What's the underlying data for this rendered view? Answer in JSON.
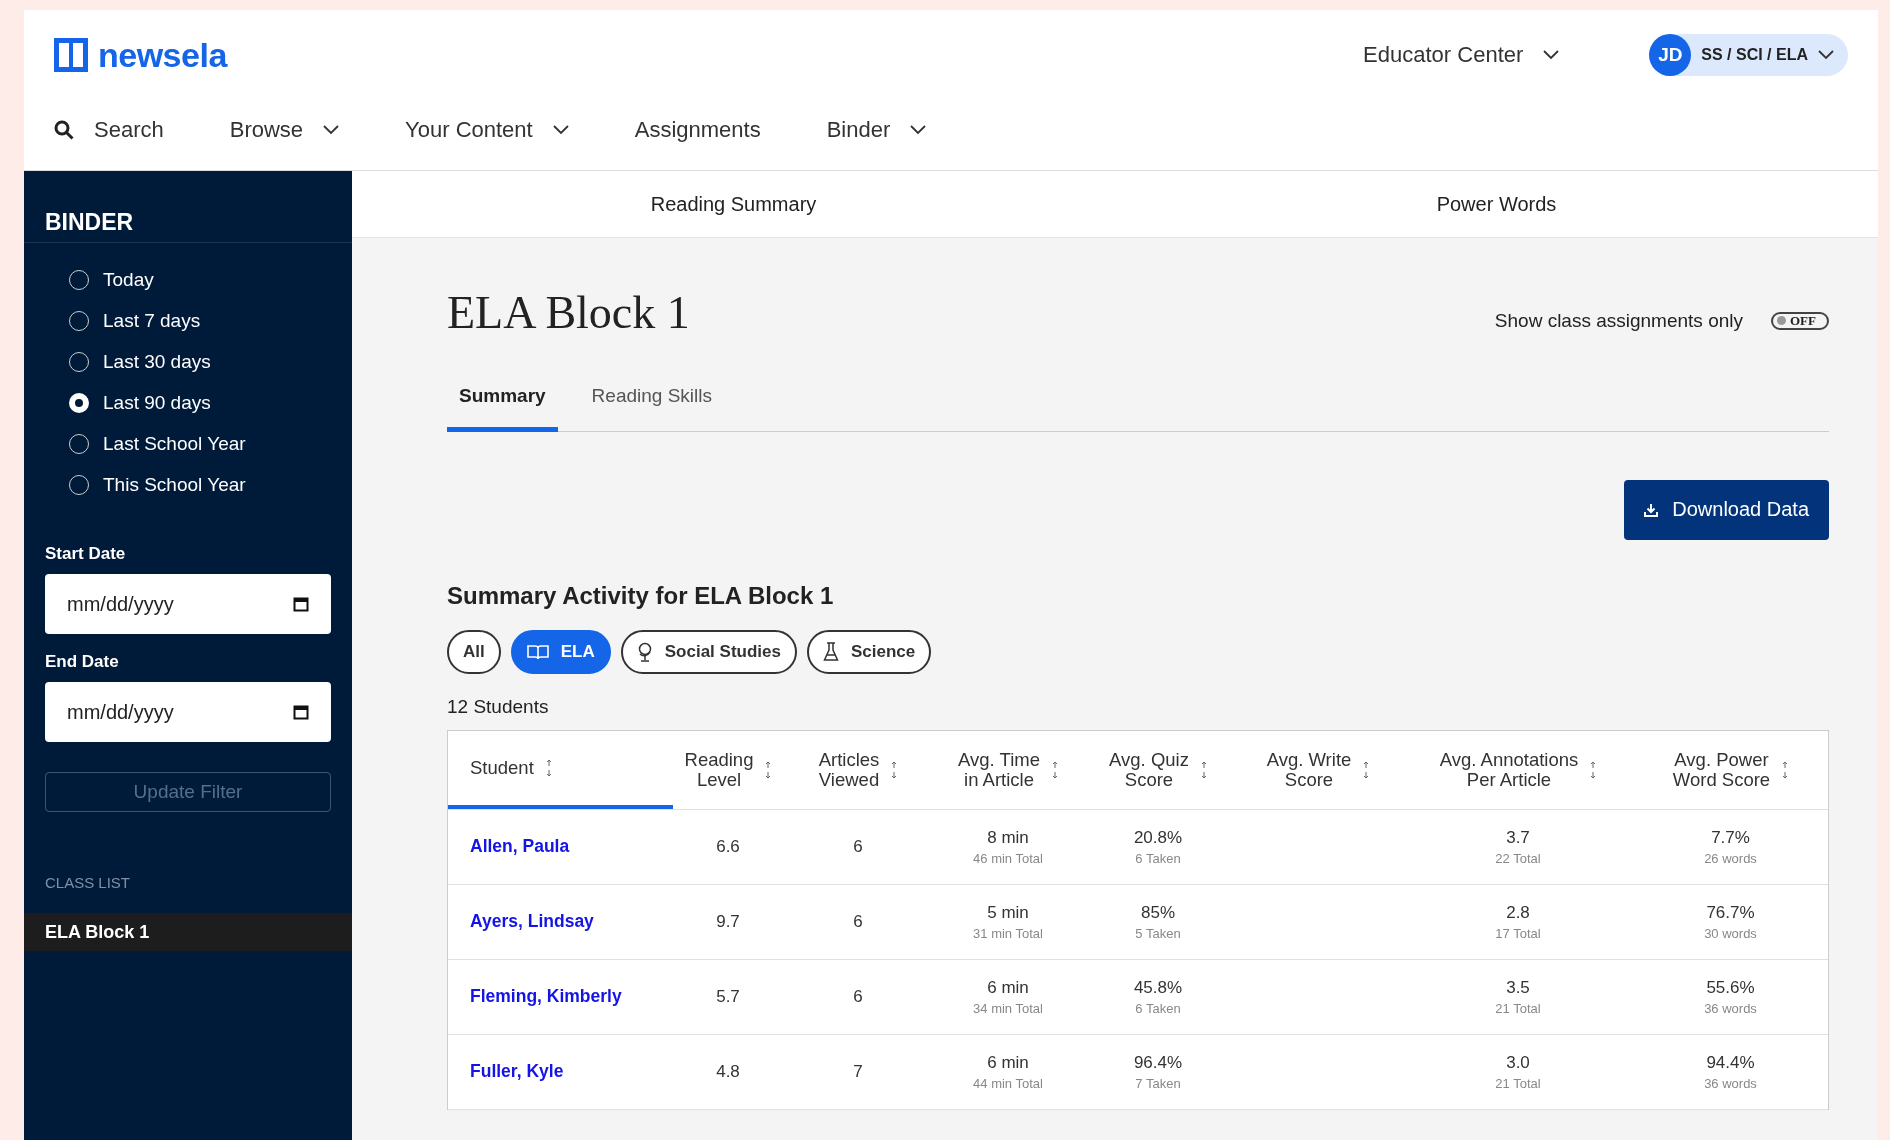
{
  "header": {
    "logo": "newsela",
    "educator_center": "Educator Center",
    "account": {
      "initials": "JD",
      "label": "SS / SCI / ELA"
    },
    "nav": [
      {
        "label": "Search",
        "kind": "search"
      },
      {
        "label": "Browse",
        "kind": "dropdown"
      },
      {
        "label": "Your Content",
        "kind": "dropdown"
      },
      {
        "label": "Assignments",
        "kind": "link"
      },
      {
        "label": "Binder",
        "kind": "dropdown"
      }
    ]
  },
  "sidebar": {
    "title": "BINDER",
    "ranges": [
      {
        "label": "Today",
        "selected": false
      },
      {
        "label": "Last 7 days",
        "selected": false
      },
      {
        "label": "Last 30 days",
        "selected": false
      },
      {
        "label": "Last 90 days",
        "selected": true
      },
      {
        "label": "Last School Year",
        "selected": false
      },
      {
        "label": "This School Year",
        "selected": false
      }
    ],
    "start_date": {
      "label": "Start Date",
      "placeholder": "mm/dd/yyyy"
    },
    "end_date": {
      "label": "End Date",
      "placeholder": "mm/dd/yyyy"
    },
    "update_button": {
      "label": "Update Filter",
      "disabled": true
    },
    "class_list_title": "CLASS LIST",
    "classes": [
      {
        "label": "ELA Block 1",
        "selected": true
      }
    ]
  },
  "subtabs": [
    "Reading Summary",
    "Power Words"
  ],
  "main": {
    "title": "ELA Block 1",
    "toggle": {
      "label": "Show class assignments only",
      "on": false,
      "state_text": "OFF"
    },
    "tabs": [
      {
        "label": "Summary",
        "selected": true
      },
      {
        "label": "Reading Skills",
        "selected": false
      }
    ],
    "download_button": "Download Data",
    "activity_title": "Summary Activity for ELA Block 1",
    "filters": [
      {
        "label": "All",
        "kind": "plain",
        "selected": false
      },
      {
        "label": "ELA",
        "kind": "book",
        "selected": true
      },
      {
        "label": "Social Studies",
        "kind": "globe",
        "selected": false
      },
      {
        "label": "Science",
        "kind": "flask",
        "selected": false
      }
    ],
    "student_count": "12 Students",
    "table": {
      "columns": [
        "Student",
        "Reading\nLevel",
        "Articles\nViewed",
        "Avg. Time\nin Article",
        "Avg. Quiz\nScore",
        "Avg. Write\nScore",
        "Avg. Annotations\nPer Article",
        "Avg. Power\nWord Score"
      ],
      "rows": [
        {
          "cells": [
            {
              "value": "Allen, Paula"
            },
            {
              "value": "6.6"
            },
            {
              "value": "6"
            },
            {
              "value": "8 min",
              "sub": "46 min Total"
            },
            {
              "value": "20.8%",
              "sub": "6 Taken"
            },
            "",
            {
              "value": "3.7",
              "sub": "22 Total"
            },
            {
              "value": "7.7%",
              "sub": "26 words"
            }
          ]
        },
        {
          "cells": [
            {
              "value": "Ayers, Lindsay"
            },
            {
              "value": "9.7"
            },
            {
              "value": "6"
            },
            {
              "value": "5 min",
              "sub": "31 min Total"
            },
            {
              "value": "85%",
              "sub": "5 Taken"
            },
            "",
            {
              "value": "2.8",
              "sub": "17 Total"
            },
            {
              "value": "76.7%",
              "sub": "30 words"
            }
          ]
        },
        {
          "cells": [
            {
              "value": "Fleming, Kimberly"
            },
            {
              "value": "5.7"
            },
            {
              "value": "6"
            },
            {
              "value": "6 min",
              "sub": "34 min Total"
            },
            {
              "value": "45.8%",
              "sub": "6 Taken"
            },
            "",
            {
              "value": "3.5",
              "sub": "21 Total"
            },
            {
              "value": "55.6%",
              "sub": "36 words"
            }
          ]
        },
        {
          "cells": [
            {
              "value": "Fuller, Kyle"
            },
            {
              "value": "4.8"
            },
            {
              "value": "7"
            },
            {
              "value": "6 min",
              "sub": "44 min Total"
            },
            {
              "value": "96.4%",
              "sub": "7 Taken"
            },
            "",
            {
              "value": "3.0",
              "sub": "21 Total"
            },
            {
              "value": "94.4%",
              "sub": "36 words"
            }
          ]
        }
      ]
    }
  }
}
